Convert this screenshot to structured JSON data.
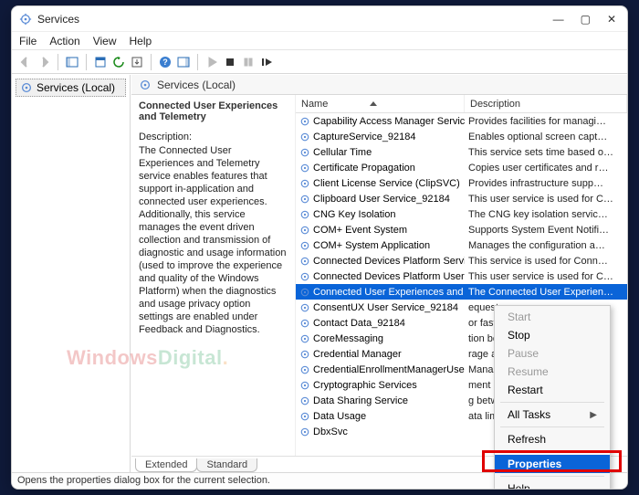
{
  "window": {
    "title": "Services"
  },
  "menubar": [
    "File",
    "Action",
    "View",
    "Help"
  ],
  "tree": {
    "root": "Services (Local)"
  },
  "right_header": "Services (Local)",
  "detail": {
    "selected_name": "Connected User Experiences and Telemetry",
    "desc_label": "Description:",
    "desc_text": "The Connected User Experiences and Telemetry service enables features that support in-application and connected user experiences. Additionally, this service manages the event driven collection and transmission of diagnostic and usage information (used to improve the experience and quality of the Windows Platform) when the diagnostics and usage privacy option settings are enabled under Feedback and Diagnostics."
  },
  "columns": {
    "name": "Name",
    "desc": "Description"
  },
  "rows": [
    {
      "name": "Capability Access Manager Service",
      "desc": "Provides facilities for managi…"
    },
    {
      "name": "CaptureService_92184",
      "desc": "Enables optional screen capt…"
    },
    {
      "name": "Cellular Time",
      "desc": "This service sets time based o…"
    },
    {
      "name": "Certificate Propagation",
      "desc": "Copies user certificates and r…"
    },
    {
      "name": "Client License Service (ClipSVC)",
      "desc": "Provides infrastructure supp…"
    },
    {
      "name": "Clipboard User Service_92184",
      "desc": "This user service is used for C…"
    },
    {
      "name": "CNG Key Isolation",
      "desc": "The CNG key isolation servic…"
    },
    {
      "name": "COM+ Event System",
      "desc": "Supports System Event Notifi…"
    },
    {
      "name": "COM+ System Application",
      "desc": "Manages the configuration a…"
    },
    {
      "name": "Connected Devices Platform Service",
      "desc": "This service is used for Conn…"
    },
    {
      "name": "Connected Devices Platform User Service…",
      "desc": "This user service is used for C…"
    },
    {
      "name": "Connected User Experiences and Telemetr…",
      "desc": "The Connected User Experien…",
      "selected": true
    },
    {
      "name": "ConsentUX User Service_92184",
      "desc": "equest …"
    },
    {
      "name": "Contact Data_92184",
      "desc": "or fast …"
    },
    {
      "name": "CoreMessaging",
      "desc": "tion be…"
    },
    {
      "name": "Credential Manager",
      "desc": "rage an…"
    },
    {
      "name": "CredentialEnrollmentManagerUserSvc_",
      "desc": "Mana…"
    },
    {
      "name": "Cryptographic Services",
      "desc": "ment …"
    },
    {
      "name": "Data Sharing Service",
      "desc": "g betw…"
    },
    {
      "name": "Data Usage",
      "desc": "ata limi…"
    },
    {
      "name": "DbxSvc",
      "desc": ""
    }
  ],
  "context_menu": {
    "start": "Start",
    "stop": "Stop",
    "pause": "Pause",
    "resume": "Resume",
    "restart": "Restart",
    "all_tasks": "All Tasks",
    "refresh": "Refresh",
    "properties": "Properties",
    "help": "Help"
  },
  "tabs": {
    "extended": "Extended",
    "standard": "Standard"
  },
  "statusbar": "Opens the properties dialog box for the current selection.",
  "watermark": {
    "a": "Windows",
    "b": "Digital",
    "c": "."
  }
}
